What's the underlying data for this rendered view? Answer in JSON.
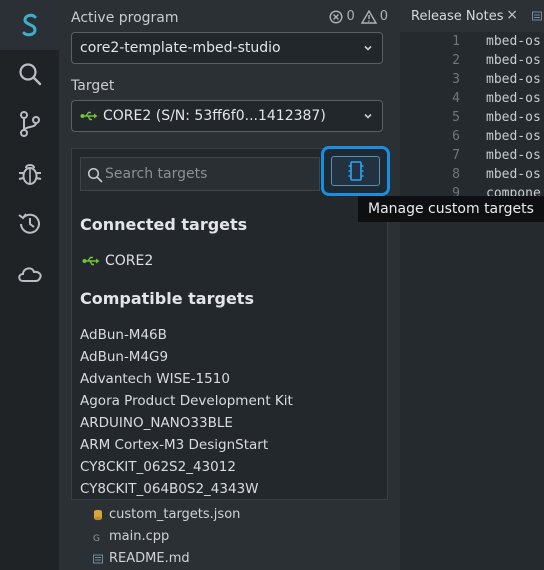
{
  "header": {
    "active_program_label": "Active program",
    "error_count": "0",
    "warning_count": "0",
    "program_value": "core2-template-mbed-studio",
    "target_label": "Target",
    "target_value": "CORE2 (S/N: 53ff6f0...1412387)"
  },
  "icons": {
    "logo": "mbed-studio-logo-icon",
    "search": "search-icon",
    "source_control": "source-control-icon",
    "debug": "bug-icon",
    "history": "history-icon",
    "cloud": "cloud-icon",
    "usb": "usb-icon",
    "chip": "chip-icon"
  },
  "dropdown": {
    "search_placeholder": "Search targets",
    "connected_title": "Connected targets",
    "connected": [
      "CORE2"
    ],
    "compatible_title": "Compatible targets",
    "compatible": [
      "AdBun-M46B",
      "AdBun-M4G9",
      "Advantech WISE-1510",
      "Agora Product Development Kit",
      "ARDUINO_NANO33BLE",
      "ARM Cortex-M3 DesignStart",
      "CY8CKIT_062S2_43012",
      "CY8CKIT_064B0S2_4343W"
    ]
  },
  "tooltip": "Manage custom targets",
  "tree": {
    "items": [
      "custom_targets.json",
      "main.cpp",
      "README.md"
    ]
  },
  "editor": {
    "tab_title": "Release Notes",
    "close": "×",
    "lines": [
      {
        "n": "1",
        "t": "mbed-os"
      },
      {
        "n": "2",
        "t": "mbed-os"
      },
      {
        "n": "3",
        "t": "mbed-os"
      },
      {
        "n": "4",
        "t": "mbed-os"
      },
      {
        "n": "5",
        "t": "mbed-os"
      },
      {
        "n": "6",
        "t": "mbed-os"
      },
      {
        "n": "7",
        "t": "mbed-os"
      },
      {
        "n": "8",
        "t": "mbed-os"
      },
      {
        "n": "9",
        "t": "compone"
      }
    ]
  },
  "colors": {
    "accent": "#1a8fe0",
    "usb_green": "#6fc43a",
    "logo": "#3fb0c9"
  }
}
